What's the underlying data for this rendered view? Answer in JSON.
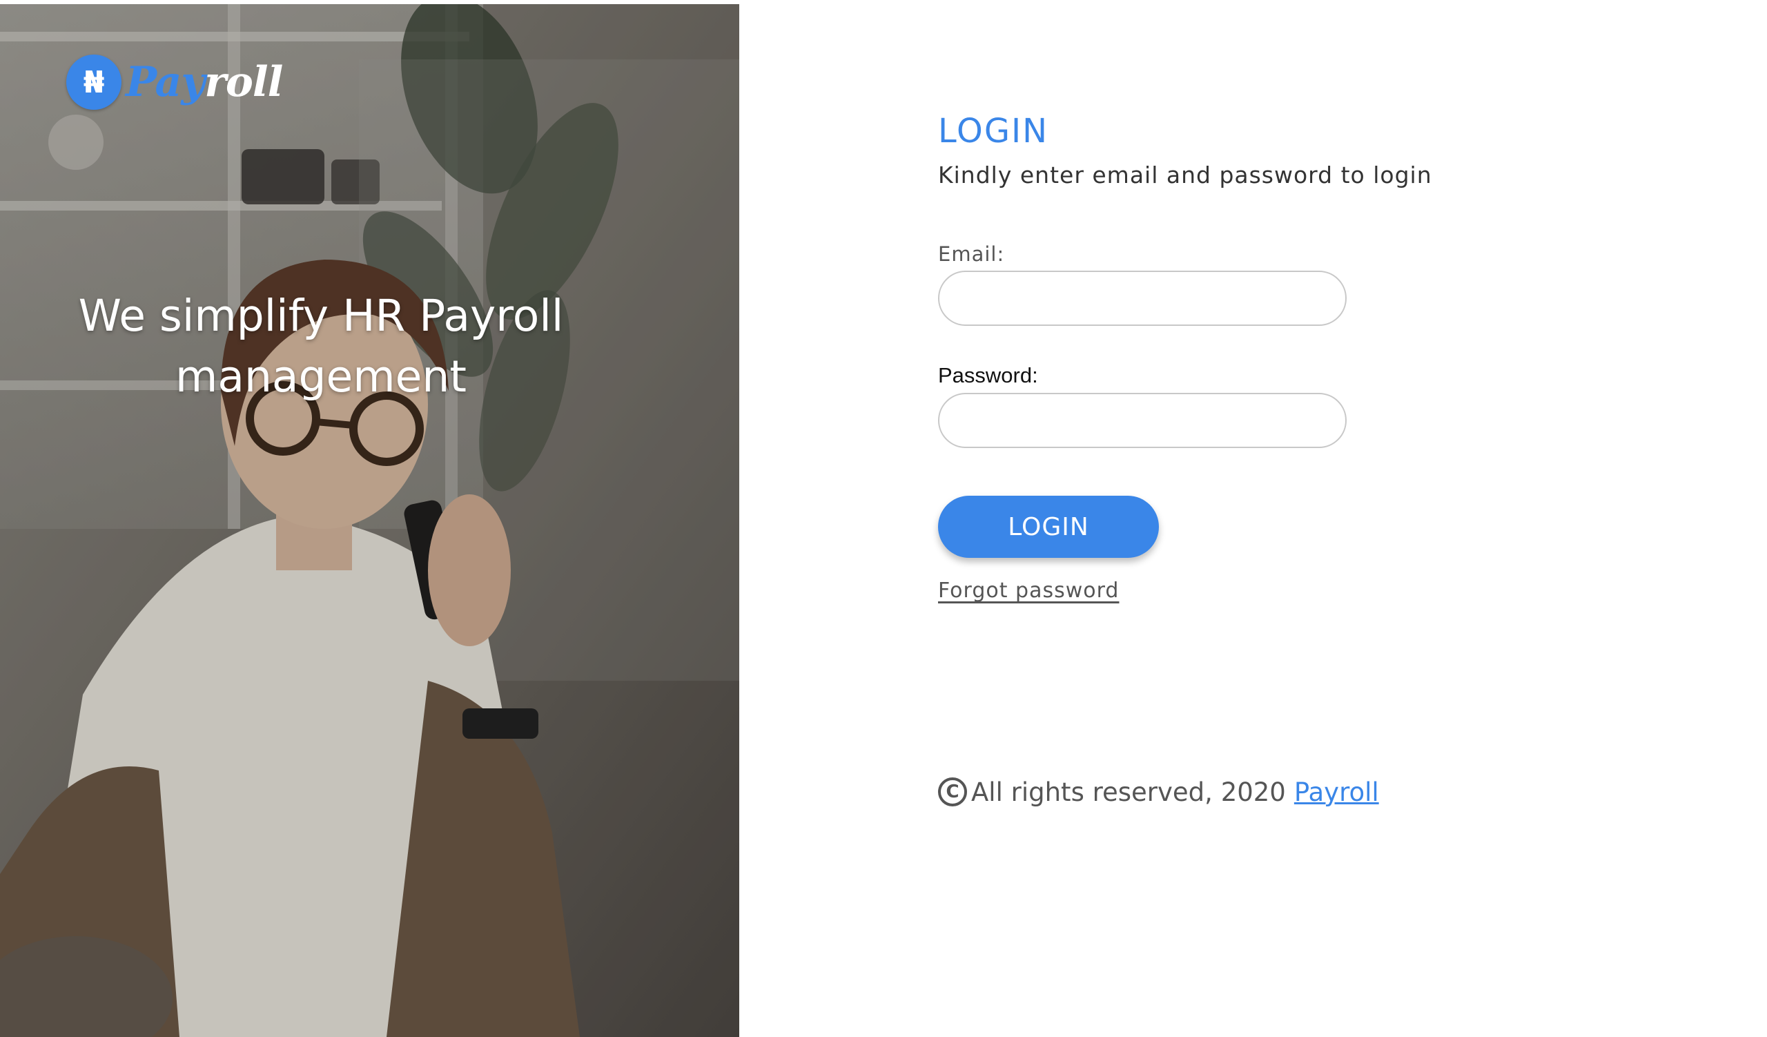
{
  "hero": {
    "logo": {
      "symbol": "₦",
      "word_part1": "Pay",
      "word_part2": "roll"
    },
    "tagline": "We simplify HR Payroll management"
  },
  "login": {
    "title": "LOGIN",
    "subtitle": "Kindly enter email and password to login",
    "email_label": "Email:",
    "email_value": "",
    "password_label": "Password:",
    "password_value": "",
    "button_label": "LOGIN",
    "forgot_label": "Forgot password"
  },
  "footer": {
    "copyright_symbol": "C",
    "text": "All rights reserved, 2020",
    "brand": "Payroll"
  },
  "colors": {
    "accent": "#3a86e8",
    "text": "#333333",
    "muted": "#555555"
  },
  "icons": [
    "naira-coin-icon",
    "copyright-icon"
  ]
}
